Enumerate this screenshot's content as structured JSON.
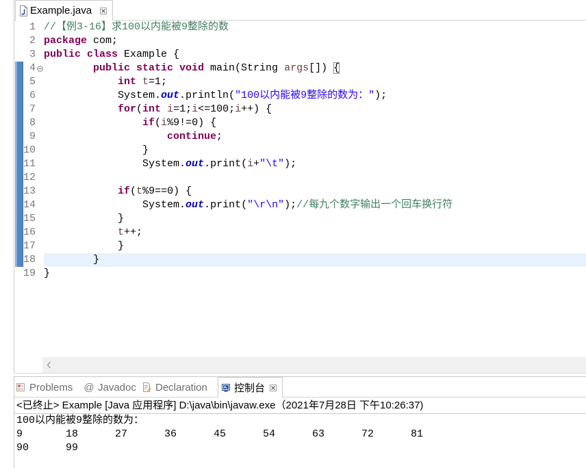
{
  "colors": {
    "keyword": "#7f0055",
    "comment": "#3f7f5f",
    "string": "#2a00ff",
    "field": "#0000c0",
    "variable": "#6a3e3e",
    "plain": "#000000",
    "line_number": "#787878",
    "current_line": "#e8f2fe",
    "range_indicator": "#4f86c6",
    "inactive_tab_text": "#6d6d6d"
  },
  "editor_tab": {
    "label": "Example.java",
    "icon": "java-file-icon",
    "close_icon": "close-icon",
    "active": true
  },
  "editor": {
    "lines": [
      {
        "number": "1",
        "tokens": [
          {
            "comment": "//【例3-16】求100以内能被9整除的数"
          }
        ]
      },
      {
        "number": "2",
        "tokens": [
          {
            "keyword": "package "
          },
          {
            "plain": "com;"
          }
        ]
      },
      {
        "number": "3",
        "tokens": [
          {
            "keyword": "public class "
          },
          {
            "plain": "Example {"
          }
        ]
      },
      {
        "number": "4",
        "fold_icon": "fold-collapse-icon",
        "in_method_range": true,
        "tokens": [
          {
            "keyword": "        public static void "
          },
          {
            "plain": "main(String "
          },
          {
            "variable": "args"
          },
          {
            "plain": "[]) "
          },
          {
            "bracket_match": "{"
          }
        ]
      },
      {
        "number": "5",
        "in_method_range": true,
        "tokens": [
          {
            "keyword": "            int "
          },
          {
            "variable": "t"
          },
          {
            "plain": "=1;"
          }
        ]
      },
      {
        "number": "6",
        "in_method_range": true,
        "tokens": [
          {
            "plain": "            System."
          },
          {
            "field": "out"
          },
          {
            "plain": ".println("
          },
          {
            "string": "\"100以内能被9整除的数为：\""
          },
          {
            "plain": ");"
          }
        ]
      },
      {
        "number": "7",
        "in_method_range": true,
        "tokens": [
          {
            "keyword": "            for"
          },
          {
            "plain": "("
          },
          {
            "keyword": "int "
          },
          {
            "variable": "i"
          },
          {
            "plain": "=1;"
          },
          {
            "variable": "i"
          },
          {
            "plain": "<=100;"
          },
          {
            "variable": "i"
          },
          {
            "plain": "++) {"
          }
        ]
      },
      {
        "number": "8",
        "in_method_range": true,
        "tokens": [
          {
            "keyword": "                if"
          },
          {
            "plain": "("
          },
          {
            "variable": "i"
          },
          {
            "plain": "%9!=0) {"
          }
        ]
      },
      {
        "number": "9",
        "in_method_range": true,
        "tokens": [
          {
            "keyword": "                    continue"
          },
          {
            "plain": ";"
          }
        ]
      },
      {
        "number": "10",
        "in_method_range": true,
        "tokens": [
          {
            "plain": "                }"
          }
        ]
      },
      {
        "number": "11",
        "in_method_range": true,
        "tokens": [
          {
            "plain": "                System."
          },
          {
            "field": "out"
          },
          {
            "plain": ".print("
          },
          {
            "variable": "i"
          },
          {
            "plain": "+"
          },
          {
            "string": "\"\\t\""
          },
          {
            "plain": ");"
          }
        ]
      },
      {
        "number": "12",
        "in_method_range": true,
        "tokens": []
      },
      {
        "number": "13",
        "in_method_range": true,
        "tokens": [
          {
            "keyword": "            if"
          },
          {
            "plain": "("
          },
          {
            "variable": "t"
          },
          {
            "plain": "%9==0) {"
          }
        ]
      },
      {
        "number": "14",
        "in_method_range": true,
        "tokens": [
          {
            "plain": "                System."
          },
          {
            "field": "out"
          },
          {
            "plain": ".print("
          },
          {
            "string": "\"\\r\\n\""
          },
          {
            "plain": ");"
          },
          {
            "comment": "//每九个数字输出一个回车换行符"
          }
        ]
      },
      {
        "number": "15",
        "in_method_range": true,
        "tokens": [
          {
            "plain": "            }"
          }
        ]
      },
      {
        "number": "16",
        "in_method_range": true,
        "tokens": [
          {
            "variable": "            t"
          },
          {
            "plain": "++;"
          }
        ]
      },
      {
        "number": "17",
        "in_method_range": true,
        "tokens": [
          {
            "plain": "            }"
          }
        ]
      },
      {
        "number": "18",
        "in_method_range": true,
        "current": true,
        "tokens": [
          {
            "plain": "        }"
          }
        ]
      },
      {
        "number": "19",
        "tokens": [
          {
            "plain": "}"
          }
        ]
      }
    ],
    "scrollbar": {
      "left_icon": "chevron-left-icon"
    }
  },
  "bottom_panel": {
    "tabs": [
      {
        "label": "Problems",
        "icon": "problems-icon",
        "active": false
      },
      {
        "label": "Javadoc",
        "icon": "javadoc-icon",
        "icon_glyph": "@",
        "active": false
      },
      {
        "label": "Declaration",
        "icon": "declaration-icon",
        "active": false
      },
      {
        "label": "控制台",
        "icon": "console-icon",
        "active": true,
        "close_icon": "close-icon"
      }
    ],
    "console": {
      "status_line": "<已终止> Example [Java 应用程序] D:\\java\\bin\\javaw.exe（2021年7月28日 下午10:26:37)",
      "output": {
        "heading": "100以内能被9整除的数为：",
        "rows": [
          [
            "9",
            "18",
            "27",
            "36",
            "45",
            "54",
            "63",
            "72",
            "81"
          ],
          [
            "90",
            "99"
          ]
        ]
      }
    }
  }
}
